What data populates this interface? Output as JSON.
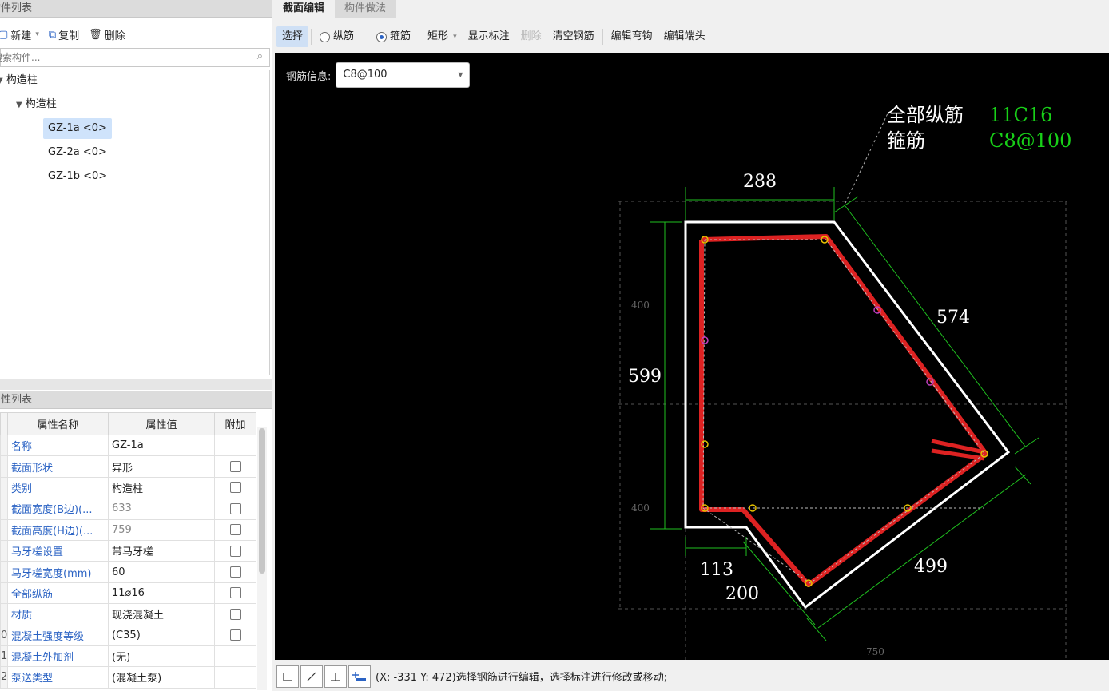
{
  "left": {
    "component_list_title": "构件列表",
    "toolbar": {
      "new_label": "新建",
      "copy_label": "复制",
      "delete_label": "删除"
    },
    "search_placeholder": "搜索构件...",
    "tree": {
      "root": "构造柱",
      "child": "构造柱",
      "items": [
        "GZ-1a <0>",
        "GZ-2a <0>",
        "GZ-1b <0>"
      ]
    },
    "property_list_title": "属性列表",
    "table_headers": {
      "name": "属性名称",
      "value": "属性值",
      "extra": "附加"
    },
    "properties": [
      {
        "num": "",
        "name": "名称",
        "value": "GZ-1a",
        "gray": false,
        "checkbox": false
      },
      {
        "num": "",
        "name": "截面形状",
        "value": "异形",
        "gray": false,
        "checkbox": true
      },
      {
        "num": "",
        "name": "类别",
        "value": "构造柱",
        "gray": false,
        "checkbox": true
      },
      {
        "num": "",
        "name": "截面宽度(B边)(...",
        "value": "633",
        "gray": true,
        "checkbox": true
      },
      {
        "num": "",
        "name": "截面高度(H边)(...",
        "value": "759",
        "gray": true,
        "checkbox": true
      },
      {
        "num": "",
        "name": "马牙槎设置",
        "value": "带马牙槎",
        "gray": false,
        "checkbox": true
      },
      {
        "num": "",
        "name": "马牙槎宽度(mm)",
        "value": "60",
        "gray": false,
        "checkbox": true
      },
      {
        "num": "",
        "name": "全部纵筋",
        "value": "11⌀16",
        "gray": false,
        "checkbox": true
      },
      {
        "num": "",
        "name": "材质",
        "value": "现浇混凝土",
        "gray": false,
        "checkbox": true
      },
      {
        "num": "0",
        "name": "混凝土强度等级",
        "value": "(C35)",
        "gray": false,
        "checkbox": true
      },
      {
        "num": "1",
        "name": "混凝土外加剂",
        "value": "(无)",
        "gray": false,
        "checkbox": false
      },
      {
        "num": "2",
        "name": "泵送类型",
        "value": "(混凝土泵)",
        "gray": false,
        "checkbox": false
      }
    ]
  },
  "right": {
    "tabs": [
      "截面编辑",
      "构件做法"
    ],
    "toolbar": {
      "select": "选择",
      "longitudinal": "纵筋",
      "stirrup": "箍筋",
      "shape": "矩形",
      "show_label": "显示标注",
      "delete": "删除",
      "clear": "清空钢筋",
      "edit_hook": "编辑弯钩",
      "edit_end": "编辑端头"
    },
    "rebar_info_label": "钢筋信息:",
    "rebar_info_value": "C8@100",
    "drawing": {
      "all_long_label": "全部纵筋",
      "all_long_value": "11C16",
      "stirrup_label": "箍筋",
      "stirrup_value": "C8@100",
      "dims": {
        "top": "288",
        "diag_upper": "574",
        "left": "599",
        "bottom_small": "113",
        "bottom_diag": "200",
        "diag_lower": "499",
        "grid_400_upper": "400",
        "grid_400_lower": "400",
        "grid_750": "750"
      }
    },
    "status": "(X: -331 Y: 472)选择钢筋进行编辑，选择标注进行修改或移动;"
  }
}
